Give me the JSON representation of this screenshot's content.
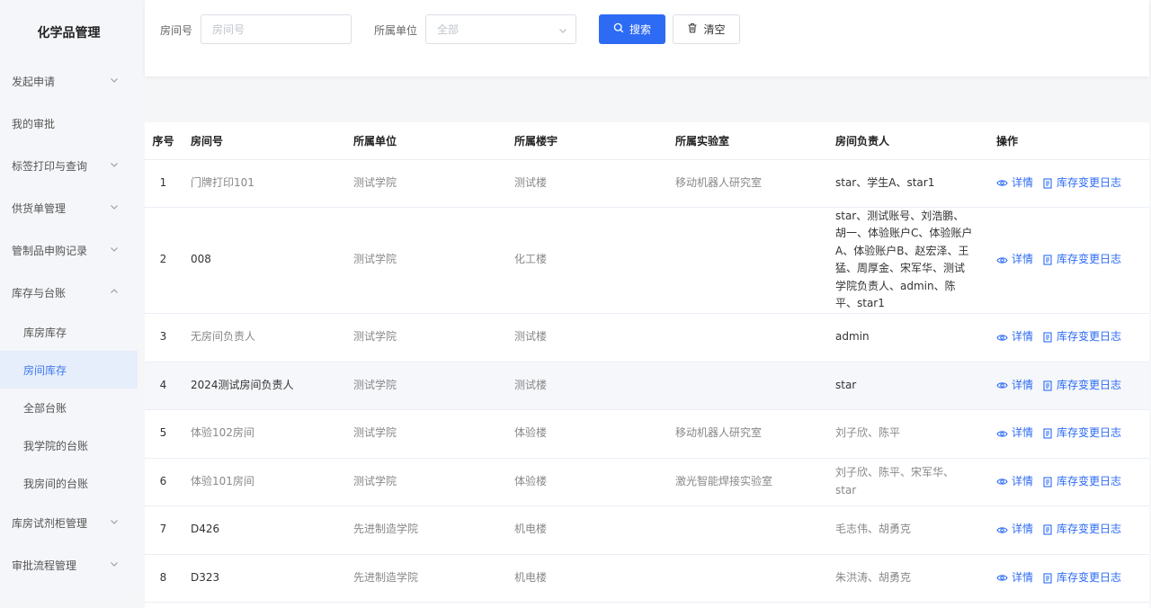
{
  "sidebar": {
    "title": "化学品管理",
    "items": [
      {
        "label": "发起申请",
        "expandable": true,
        "expanded": false
      },
      {
        "label": "我的审批",
        "expandable": false
      },
      {
        "label": "标签打印与查询",
        "expandable": true,
        "expanded": false
      },
      {
        "label": "供货单管理",
        "expandable": true,
        "expanded": false
      },
      {
        "label": "管制品申购记录",
        "expandable": true,
        "expanded": false
      },
      {
        "label": "库存与台账",
        "expandable": true,
        "expanded": true
      },
      {
        "label": "库房库存",
        "sub": true
      },
      {
        "label": "房间库存",
        "sub": true,
        "active": true
      },
      {
        "label": "全部台账",
        "sub": true
      },
      {
        "label": "我学院的台账",
        "sub": true
      },
      {
        "label": "我房间的台账",
        "sub": true
      },
      {
        "label": "库房试剂柜管理",
        "expandable": true,
        "expanded": false
      },
      {
        "label": "审批流程管理",
        "expandable": true,
        "expanded": false
      }
    ]
  },
  "filters": {
    "room_label": "房间号",
    "room_placeholder": "房间号",
    "room_value": "",
    "unit_label": "所属单位",
    "unit_selected": "全部",
    "search_button": "搜索",
    "clear_button": "清空"
  },
  "table": {
    "headers": [
      "序号",
      "房间号",
      "所属单位",
      "所属楼宇",
      "所属实验室",
      "房间负责人",
      "操作"
    ],
    "actions": {
      "detail": "详情",
      "log": "库存变更日志"
    },
    "rows": [
      {
        "no": "1",
        "room": "门牌打印101",
        "unit": "测试学院",
        "building": "测试楼",
        "lab": "移动机器人研究室",
        "owner": "star、学生A、star1"
      },
      {
        "no": "2",
        "room": "008",
        "unit": "测试学院",
        "building": "化工楼",
        "lab": "",
        "owner": "star、测试账号、刘浩鹏、胡一、体验账户C、体验账户A、体验账户B、赵宏泽、王猛、周厚金、宋军华、测试学院负责人、admin、陈平、star1"
      },
      {
        "no": "3",
        "room": "无房间负责人",
        "unit": "测试学院",
        "building": "测试楼",
        "lab": "",
        "owner": "admin"
      },
      {
        "no": "4",
        "room": "2024测试房间负责人",
        "unit": "测试学院",
        "building": "测试楼",
        "lab": "",
        "owner": "star"
      },
      {
        "no": "5",
        "room": "体验102房间",
        "unit": "测试学院",
        "building": "体验楼",
        "lab": "移动机器人研究室",
        "owner": "刘子欣、陈平"
      },
      {
        "no": "6",
        "room": "体验101房间",
        "unit": "测试学院",
        "building": "体验楼",
        "lab": "激光智能焊接实验室",
        "owner": "刘子欣、陈平、宋军华、star"
      },
      {
        "no": "7",
        "room": "D426",
        "unit": "先进制造学院",
        "building": "机电楼",
        "lab": "",
        "owner": "毛志伟、胡勇克"
      },
      {
        "no": "8",
        "room": "D323",
        "unit": "先进制造学院",
        "building": "机电楼",
        "lab": "",
        "owner": "朱洪涛、胡勇克"
      }
    ]
  }
}
